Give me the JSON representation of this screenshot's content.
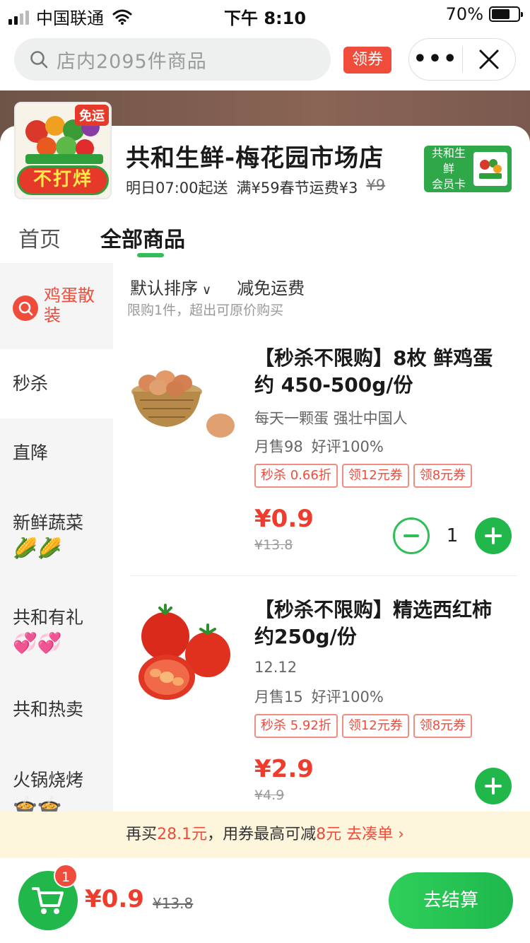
{
  "status_bar": {
    "carrier": "中国联通",
    "time": "下午 8:10",
    "battery_percent": "70%",
    "battery_level": 0.7
  },
  "search": {
    "placeholder": "店内2095件商品",
    "coupon_label": "领券"
  },
  "capsule": {
    "more_label": "•••"
  },
  "shop": {
    "logo_banner": "不打烊",
    "logo_badge": "免运",
    "name": "共和生鲜-梅花园市场店",
    "delivery_time": "明日07:00起送",
    "delivery_fee": "满¥59春节运费¥3",
    "original_fee": "¥9",
    "member_card_line1": "共和生鲜",
    "member_card_line2": "会员卡"
  },
  "tabs": [
    {
      "label": "首页",
      "active": false
    },
    {
      "label": "全部商品",
      "active": true
    }
  ],
  "sidebar": {
    "search_item": "鸡蛋散装",
    "items": [
      {
        "label": "秒杀",
        "emoji": "",
        "active": true
      },
      {
        "label": "直降",
        "emoji": "",
        "active": false
      },
      {
        "label": "新鲜蔬菜",
        "emoji": "🌽🌽",
        "active": false
      },
      {
        "label": "共和有礼",
        "emoji": "💞💞",
        "active": false
      },
      {
        "label": "共和热卖",
        "emoji": "",
        "active": false
      },
      {
        "label": "火锅烧烤",
        "emoji": "🍲🍲",
        "active": false
      }
    ]
  },
  "filter": {
    "sort_label": "默认排序",
    "shipping_label": "减免运费",
    "limit_note": "限购1件，超出可原价购买"
  },
  "products": [
    {
      "title": "【秒杀不限购】8枚 鲜鸡蛋 约 450-500g/份",
      "subtitle": "每天一颗蛋 强壮中国人",
      "monthly_sales": "月售98",
      "rating": "好评100%",
      "tags": [
        "秒杀 0.66折",
        "领12元券",
        "领8元券"
      ],
      "price": "¥0.9",
      "original_price": "¥13.8",
      "quantity": "1"
    },
    {
      "title": "【秒杀不限购】精选西红柿 约250g/份",
      "subtitle": "12.12",
      "monthly_sales": "月售15",
      "rating": "好评100%",
      "tags": [
        "秒杀 5.92折",
        "领12元券",
        "领8元券"
      ],
      "price": "¥2.9",
      "original_price": "¥4.9"
    }
  ],
  "promo": {
    "prefix": "再买",
    "amount": "28.1元",
    "middle": "，用券最高可减",
    "discount": "8元",
    "action": "去凑单",
    "arrow": "›"
  },
  "bottom_bar": {
    "cart_count": "1",
    "total": "¥0.9",
    "original_total": "¥13.8",
    "checkout_label": "去结算"
  },
  "colors": {
    "accent_green": "#21b74a",
    "price_red": "#ef3c2c",
    "promo_bg": "#fdf6dc"
  }
}
